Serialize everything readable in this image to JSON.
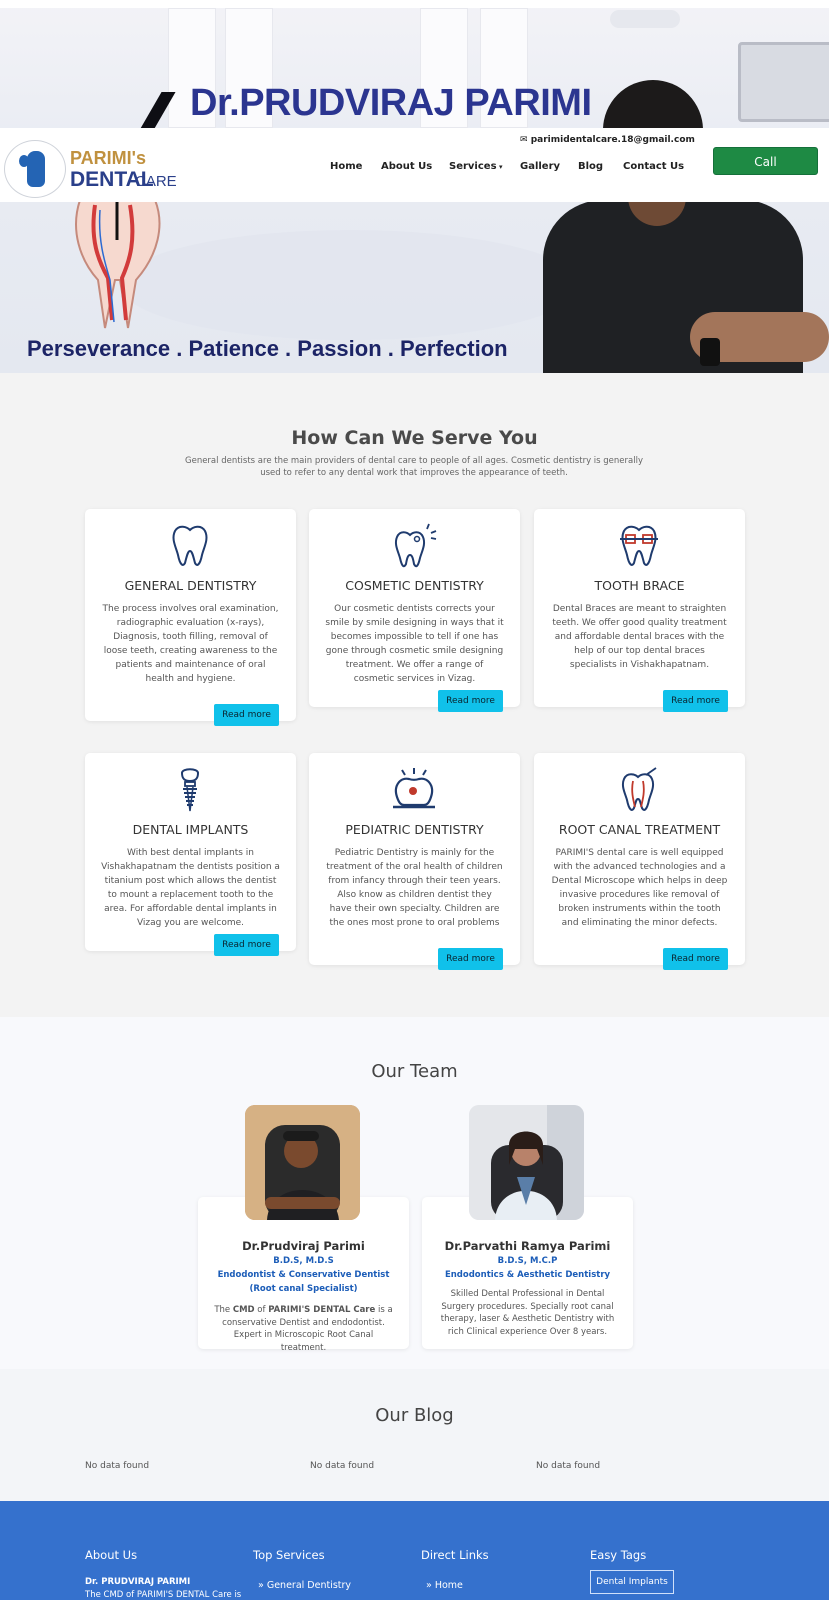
{
  "hero": {
    "doctor_name": "Dr.PRUDVIRAJ PARIMI",
    "tagline": "Perseverance . Patience . Passion . Perfection"
  },
  "header": {
    "brand": {
      "line1": "PARIMI's",
      "line2": "DENTAL",
      "line3": "CARE"
    },
    "email_icon": "envelope-icon",
    "email": "parimidentalcare.18@gmail.com",
    "nav": [
      {
        "label": "Home"
      },
      {
        "label": "About Us"
      },
      {
        "label": "Services"
      },
      {
        "label": "Gallery"
      },
      {
        "label": "Blog"
      },
      {
        "label": "Contact Us"
      }
    ],
    "call_label": "Call",
    "call_color": "#1e8a44"
  },
  "services": {
    "title": "How Can We Serve You",
    "subtitle": "General dentists are the main providers of dental care to people of all ages. Cosmetic dentistry is generally used to refer to any dental work that improves the appearance of teeth.",
    "read_more": "Read more",
    "accent_color": "#10c1ea",
    "cards": [
      {
        "icon": "tooth-icon",
        "title": "GENERAL DENTISTRY",
        "text": "The process involves oral examination, radiographic evaluation (x-rays), Diagnosis, tooth filling, removal of loose teeth, creating awareness to the patients and maintenance of oral health and hygiene."
      },
      {
        "icon": "sparkling-tooth-icon",
        "title": "COSMETIC DENTISTRY",
        "text": "Our cosmetic dentists corrects your smile by smile designing in ways that it becomes impossible to tell if one has gone through cosmetic smile designing treatment. We offer a range of cosmetic services in Vizag."
      },
      {
        "icon": "tooth-brace-icon",
        "title": "TOOTH BRACE",
        "text": "Dental Braces are meant to straighten teeth. We offer good quality treatment and affordable dental braces with the help of our top dental braces specialists in Vishakhapatnam."
      },
      {
        "icon": "dental-implant-icon",
        "title": "DENTAL IMPLANTS",
        "text": "With best dental implants in Vishakhapatnam the dentists position a titanium post which allows the dentist to mount a replacement tooth to the area. For affordable dental implants in Vizag you are welcome."
      },
      {
        "icon": "pediatric-tooth-icon",
        "title": "PEDIATRIC DENTISTRY",
        "text": "Pediatric Dentistry is mainly for the treatment of the oral health of children from infancy through their teen years. Also know as children dentist they have their own specialty. Children are the ones most prone to oral problems"
      },
      {
        "icon": "root-canal-icon",
        "title": "ROOT CANAL TREATMENT",
        "text": "PARIMI'S dental care is well equipped with the advanced technologies and a Dental Microscope which helps in deep invasive procedures like removal of broken instruments within the tooth and eliminating the minor defects."
      }
    ]
  },
  "social": [
    {
      "name": "facebook-icon",
      "color": "#1877f2"
    },
    {
      "name": "instagram-icon",
      "color": "#d62d55"
    },
    {
      "name": "whatsapp-icon",
      "color": "#1f8f4a"
    }
  ],
  "team": {
    "title": "Our Team",
    "members": [
      {
        "name": "Dr.Prudviraj Parimi",
        "degree": "B.D.S, M.D.S",
        "role1": "Endodontist & Conservative Dentist",
        "role2": "(Root canal Specialist)",
        "bio_the": "The ",
        "bio_cmd": "CMD",
        "bio_of": " of ",
        "bio_brand": "PARIMI'S DENTAL Care",
        "bio_rest": " is a conservative Dentist and endodontist. Expert in Microscopic Root Canal treatment."
      },
      {
        "name": "Dr.Parvathi Ramya Parimi",
        "degree": "B.D.S, M.C.P",
        "role1": "Endodontics & Aesthetic Dentistry",
        "bio": "Skilled Dental Professional in Dental Surgery procedures. Specially root canal therapy, laser & Aesthetic Dentistry with rich Clinical experience Over 8 years."
      }
    ]
  },
  "blog": {
    "title": "Our Blog",
    "empty": [
      "No data found",
      "No data found",
      "No data found"
    ]
  },
  "footer": {
    "bg_color": "#3571cd",
    "about_title": "About Us",
    "about_name": "Dr. PRUDVIRAJ PARIMI",
    "about_text": "The CMD of PARIMI'S DENTAL Care is",
    "services_title": "Top Services",
    "services_item": "General Dentistry",
    "links_title": "Direct Links",
    "links_item": "Home",
    "tags_title": "Easy Tags",
    "tag": "Dental Implants"
  }
}
